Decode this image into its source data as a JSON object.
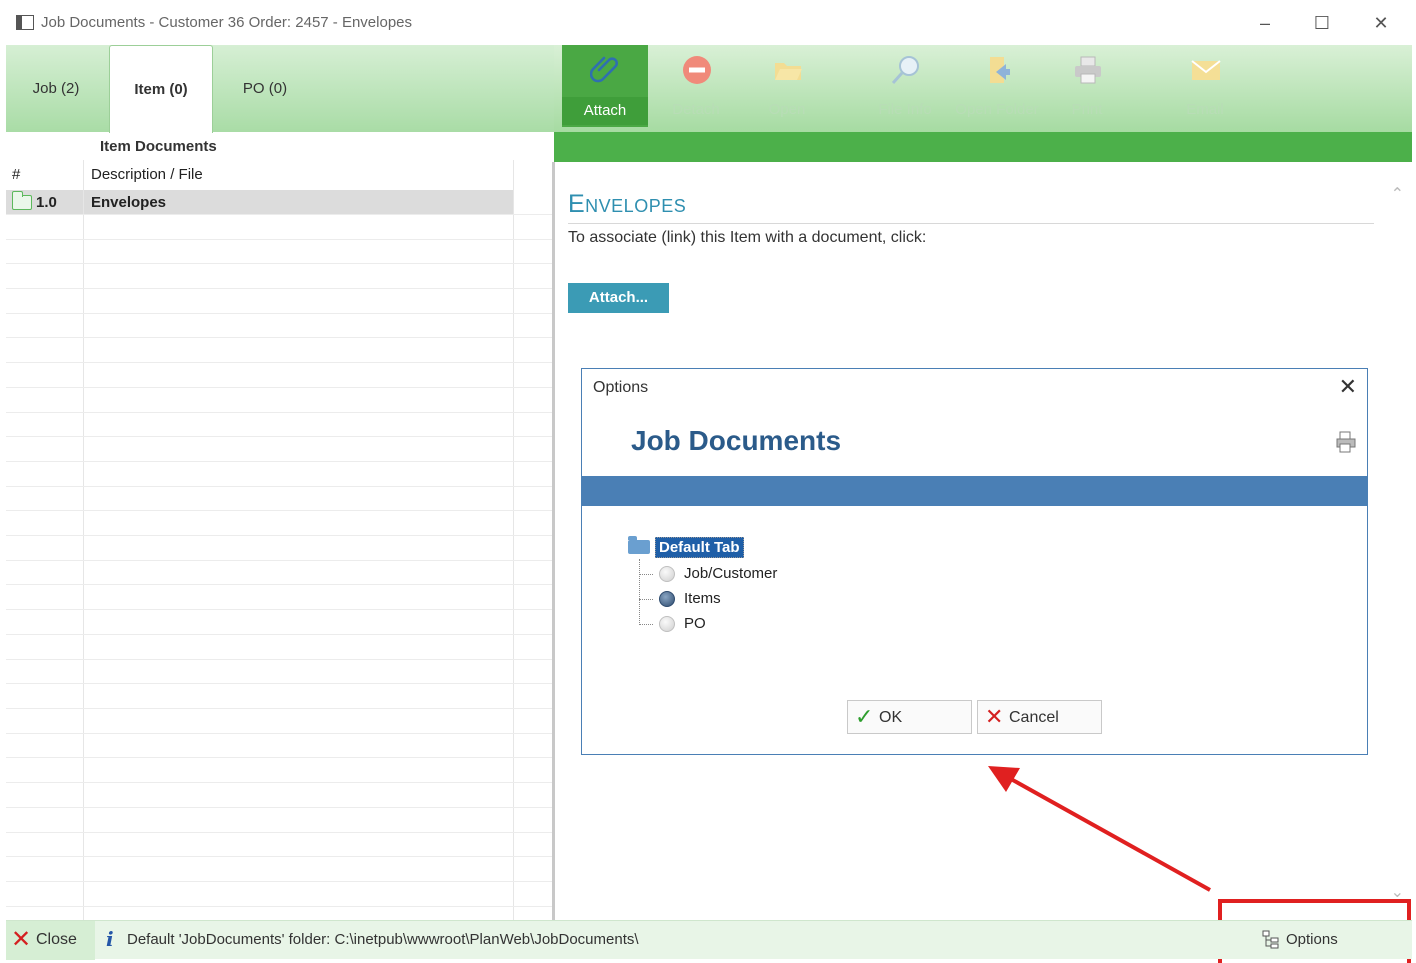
{
  "window": {
    "title": "Job Documents - Customer 36 Order: 2457 - Envelopes",
    "controls": [
      "minimize",
      "maximize",
      "close"
    ]
  },
  "tabs": [
    {
      "label": "Job (2)",
      "active": false
    },
    {
      "label": "Item (0)",
      "active": true
    },
    {
      "label": "PO (0)",
      "active": false
    }
  ],
  "toolbar": {
    "buttons": [
      {
        "label": "Attach",
        "icon": "paperclip-icon",
        "enabled": true
      },
      {
        "label": "Detach",
        "icon": "minus-circle-icon",
        "enabled": false
      },
      {
        "label": "Open",
        "icon": "folder-open-icon",
        "enabled": false
      },
      {
        "label": "File Info",
        "icon": "magnifier-icon",
        "enabled": false
      },
      {
        "label": "Open Folder",
        "icon": "folder-arrow-icon",
        "enabled": false
      },
      {
        "label": "Print",
        "icon": "printer-icon",
        "enabled": false
      },
      {
        "label": "Email",
        "icon": "envelope-icon",
        "enabled": false
      }
    ]
  },
  "grid": {
    "title": "Item Documents",
    "columns": [
      "#",
      "Description / File"
    ],
    "rows": [
      {
        "num": "1.0",
        "description": "Envelopes",
        "selected": true
      }
    ]
  },
  "panel": {
    "heading": "Envelopes",
    "instruction": "To associate (link) this Item with a document, click:",
    "attach_button": "Attach..."
  },
  "dialog": {
    "title": "Options",
    "heading": "Job Documents",
    "tree": {
      "root": "Default Tab",
      "options": [
        {
          "label": "Job/Customer",
          "selected": false
        },
        {
          "label": "Items",
          "selected": true
        },
        {
          "label": "PO",
          "selected": false
        }
      ]
    },
    "ok_label": "OK",
    "cancel_label": "Cancel"
  },
  "statusbar": {
    "close_label": "Close",
    "info_text": "Default 'JobDocuments' folder: C:\\inetpub\\wwwroot\\PlanWeb\\JobDocuments\\",
    "options_label": "Options"
  },
  "colors": {
    "accent_green": "#4cb04a",
    "attach_button": "#3b9bb5",
    "dialog_band": "#4a7fb5",
    "annotation_red": "#e02020"
  }
}
